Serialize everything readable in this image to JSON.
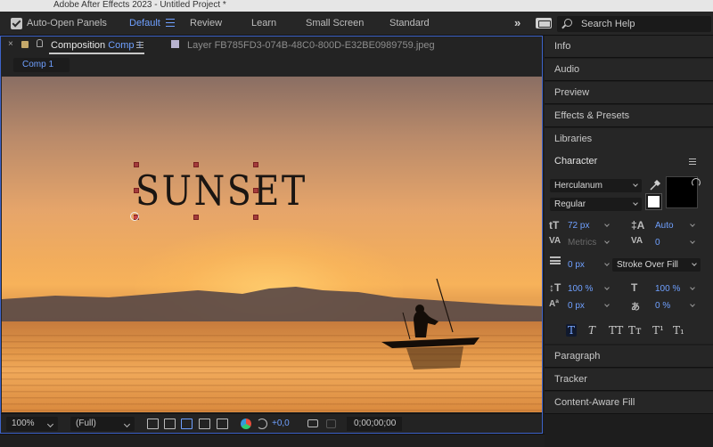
{
  "app": {
    "title": "Adobe After Effects 2023 - Untitled Project *"
  },
  "workspace": {
    "auto_open": "Auto-Open Panels",
    "tabs": [
      "Default",
      "Review",
      "Learn",
      "Small Screen",
      "Standard"
    ],
    "active": "Default",
    "overflow": "»",
    "search_placeholder": "Search Help"
  },
  "composition": {
    "close": "×",
    "tab_label_prefix": "Composition",
    "tab_label_name": "Comp 1",
    "layer_tab": "Layer FB785FD3-074B-48C0-800D-E32BE0989759.jpeg",
    "subtab": "Comp 1",
    "text_layer": "SUNSET",
    "footer": {
      "zoom": "100%",
      "resolution": "(Full)",
      "exposure": "+0,0",
      "timecode": "0;00;00;00"
    }
  },
  "right_panels": {
    "top": [
      "Info",
      "Audio",
      "Preview",
      "Effects & Presets",
      "Libraries"
    ],
    "character": {
      "title": "Character",
      "font": "Herculanum",
      "style": "Regular",
      "font_size": "72 px",
      "leading": "Auto",
      "kerning": "Metrics",
      "tracking": "0",
      "stroke_width": "0 px",
      "stroke_mode": "Stroke Over Fill",
      "vert_scale": "100 %",
      "horiz_scale": "100 %",
      "baseline_shift": "0 px",
      "tsume": "0 %",
      "style_buttons": [
        "T",
        "T",
        "TT",
        "Tт",
        "T¹",
        "T₁"
      ]
    },
    "bottom": [
      "Paragraph",
      "Tracker",
      "Content-Aware Fill"
    ]
  },
  "colors": {
    "accent": "#6fa0ff",
    "panel_border": "#3d63c9",
    "fill_color": "#000000",
    "stroke_color": "#ffffff"
  }
}
